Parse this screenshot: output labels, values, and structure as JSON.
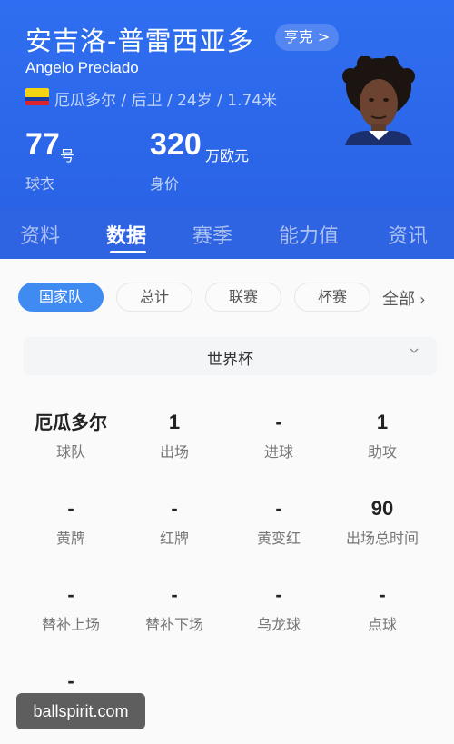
{
  "player": {
    "name_cn": "安吉洛-普雷西亚多",
    "name_en": "Angelo Preciado",
    "club_chip": "亨克 >",
    "meta": "厄瓜多尔 / 后卫 / 24岁 / 1.74米",
    "shirt_number": "77",
    "shirt_unit": "号",
    "shirt_label": "球衣",
    "market_value": "320",
    "value_unit": "万欧元",
    "value_label": "身价"
  },
  "tabs": [
    "资料",
    "数据",
    "赛季",
    "能力值",
    "资讯"
  ],
  "active_tab": "数据",
  "filters": [
    "国家队",
    "总计",
    "联赛",
    "杯赛"
  ],
  "filters_more": "全部",
  "competition": "世界杯",
  "stats": [
    {
      "value": "厄瓜多尔",
      "label": "球队"
    },
    {
      "value": "1",
      "label": "出场"
    },
    {
      "value": "-",
      "label": "进球"
    },
    {
      "value": "1",
      "label": "助攻"
    },
    {
      "value": "-",
      "label": "黄牌"
    },
    {
      "value": "-",
      "label": "红牌"
    },
    {
      "value": "-",
      "label": "黄变红"
    },
    {
      "value": "90",
      "label": "出场总时间"
    },
    {
      "value": "-",
      "label": "替补上场"
    },
    {
      "value": "-",
      "label": "替补下场"
    },
    {
      "value": "-",
      "label": "乌龙球"
    },
    {
      "value": "-",
      "label": "点球"
    },
    {
      "value": "-",
      "label": ""
    }
  ],
  "watermark": "ballspirit.com",
  "colors": {
    "header_blue": "#2f6ef0",
    "accent_blue": "#3f8bf2"
  }
}
